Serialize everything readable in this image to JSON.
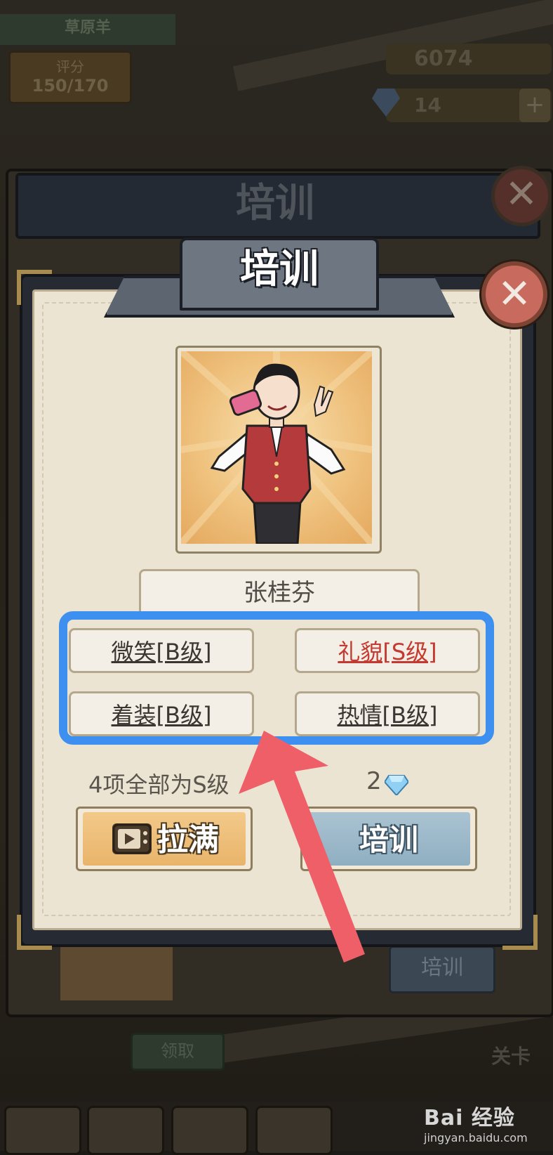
{
  "background": {
    "store_name": "草原羊",
    "score_label": "评分",
    "score_value": "150/170",
    "coins": "6074",
    "gems": "14",
    "plus": "+",
    "outer_title": "培训",
    "outer_train_button": "培训",
    "claim_button": "领取",
    "level_card": "关卡"
  },
  "dialog": {
    "title": "培训",
    "close_glyph": "✕",
    "employee_name": "张桂芬",
    "stats": [
      {
        "label": "微笑[B级]",
        "grade": "B"
      },
      {
        "label": "礼貌[S级]",
        "grade": "S"
      },
      {
        "label": "着装[B级]",
        "grade": "B"
      },
      {
        "label": "热情[B级]",
        "grade": "B"
      }
    ],
    "requirement_text": "4项全部为S级",
    "cost_value": "2",
    "cost_icon": "diamond-icon",
    "fill_button_label": "拉满",
    "fill_button_icon": "video-ad-icon",
    "train_button_label": "培训"
  },
  "annotation": {
    "highlight_color": "#3d8ff0",
    "arrow_color": "#ef5f68"
  },
  "watermark": {
    "main": "Bai 经验",
    "sub": "jingyan.baidu.com"
  },
  "colors": {
    "s_grade": "#c53a30",
    "b_grade": "#3a3632",
    "fill_button": "#e9b46a",
    "train_button": "#8fafc1"
  }
}
